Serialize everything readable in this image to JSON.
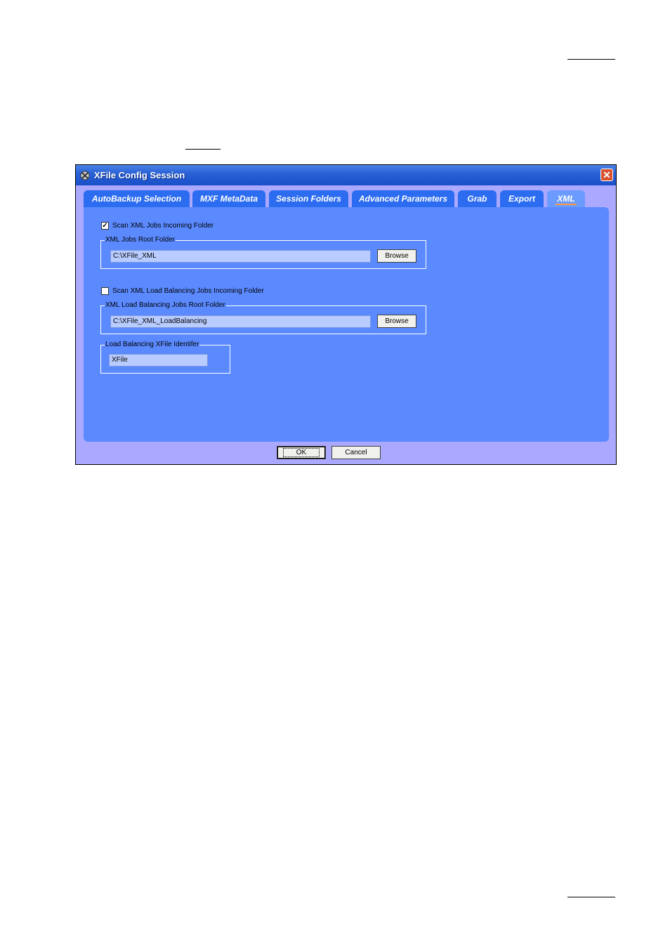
{
  "window": {
    "title": "XFile Config Session",
    "close_symbol": "✕",
    "app_icon": "xfile-app-icon"
  },
  "tabs": [
    {
      "label": "AutoBackup Selection",
      "active": false
    },
    {
      "label": "MXF MetaData",
      "active": false
    },
    {
      "label": "Session Folders",
      "active": false
    },
    {
      "label": "Advanced Parameters",
      "active": false
    },
    {
      "label": "Grab",
      "active": false
    },
    {
      "label": "Export",
      "active": false
    },
    {
      "label": "XML",
      "active": true
    }
  ],
  "xml_tab": {
    "scan_jobs": {
      "label": "Scan XML Jobs Incoming Folder",
      "checked": true
    },
    "jobs_root": {
      "group_label": "XML Jobs Root Folder",
      "value": "C:\\XFile_XML",
      "browse_label": "Browse"
    },
    "scan_lb": {
      "label": "Scan XML Load Balancing Jobs Incoming Folder",
      "checked": false
    },
    "lb_root": {
      "group_label": "XML Load Balancing Jobs Root Folder",
      "value": "C:\\XFile_XML_LoadBalancing",
      "browse_label": "Browse"
    },
    "lb_identifier": {
      "group_label": "Load Balancing XFile Identifer",
      "value": "XFile"
    }
  },
  "footer": {
    "ok_label": "OK",
    "cancel_label": "Cancel"
  },
  "colors": {
    "panel": "#5b8aff",
    "tab": "#2c6cf0",
    "window_frame": "#aaa8ff",
    "titlebar": "#2a62d6"
  }
}
